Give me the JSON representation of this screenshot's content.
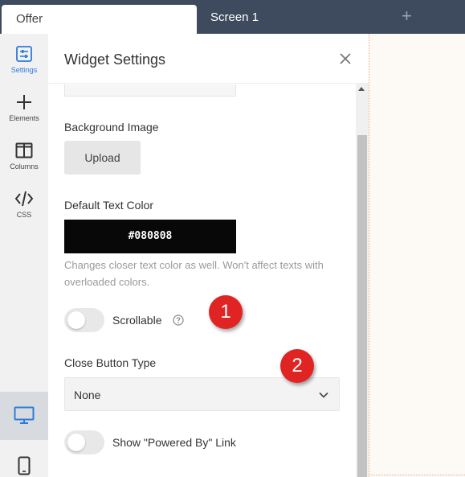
{
  "tabs": {
    "active": "Offer",
    "screen": "Screen 1",
    "add": "+"
  },
  "rail": {
    "items": [
      {
        "label": "Settings",
        "icon": "settings-sliders-icon"
      },
      {
        "label": "Elements",
        "icon": "plus-icon"
      },
      {
        "label": "Columns",
        "icon": "columns-icon"
      },
      {
        "label": "CSS",
        "icon": "code-icon"
      }
    ],
    "devices": [
      "desktop-icon",
      "mobile-icon"
    ]
  },
  "panel": {
    "title": "Widget Settings",
    "background_image_label": "Background Image",
    "upload_label": "Upload",
    "default_text_color_label": "Default Text Color",
    "default_text_color_value": "#080808",
    "hint": "Changes closer text color as well. Won't affect texts with overloaded colors.",
    "scrollable_label": "Scrollable",
    "scrollable_on": false,
    "close_button_type_label": "Close Button Type",
    "close_button_type_value": "None",
    "powered_by_label": "Show \"Powered By\" Link",
    "powered_by_on": false
  },
  "annotations": [
    "1",
    "2"
  ],
  "colors": {
    "tabbar": "#3e4b5e",
    "accent": "#2f7bd9",
    "badge": "#e02424",
    "swatch": "#080808"
  }
}
